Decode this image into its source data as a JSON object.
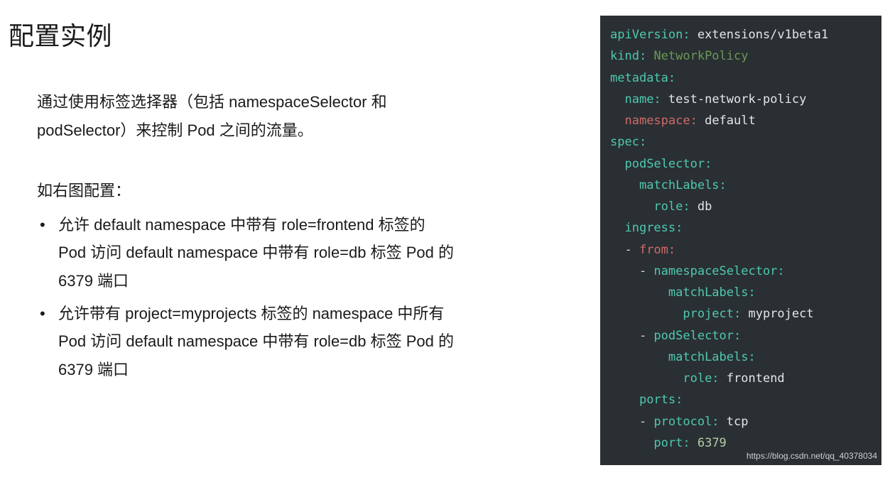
{
  "title": "配置实例",
  "intro_line1": "通过使用标签选择器（包括 namespaceSelector 和",
  "intro_line2": "podSelector）来控制 Pod 之间的流量。",
  "subheading": "如右图配置：",
  "bullets": [
    "允许 default namespace 中带有 role=frontend 标签的 Pod 访问 default namespace 中带有 role=db 标签 Pod 的 6379 端口",
    "允许带有 project=myprojects 标签的 namespace 中所有 Pod 访问 default namespace 中带有 role=db 标签 Pod 的 6379 端口"
  ],
  "code": {
    "l1_key": "apiVersion:",
    "l1_val": " extensions/v1beta1",
    "l2_key": "kind:",
    "l2_val": " NetworkPolicy",
    "l3_key": "metadata:",
    "l4_prefix": "  ",
    "l4_key": "name:",
    "l4_val": " test-network-policy",
    "l5_prefix": "  ",
    "l5_key": "namespace:",
    "l5_val": " default",
    "l6_key": "spec:",
    "l7_prefix": "  ",
    "l7_key": "podSelector:",
    "l8_prefix": "    ",
    "l8_key": "matchLabels:",
    "l9_prefix": "      ",
    "l9_key": "role:",
    "l9_val": " db",
    "l10_prefix": "  ",
    "l10_key": "ingress:",
    "l11_prefix": "  - ",
    "l11_key": "from:",
    "l12_prefix": "    - ",
    "l12_key": "namespaceSelector:",
    "l13_prefix": "        ",
    "l13_key": "matchLabels:",
    "l14_prefix": "          ",
    "l14_key": "project:",
    "l14_val": " myproject",
    "l15_prefix": "    - ",
    "l15_key": "podSelector:",
    "l16_prefix": "        ",
    "l16_key": "matchLabels:",
    "l17_prefix": "          ",
    "l17_key": "role:",
    "l17_val": " frontend",
    "l18_prefix": "    ",
    "l18_key": "ports:",
    "l19_prefix": "    - ",
    "l19_key": "protocol:",
    "l19_val": " tcp",
    "l20_prefix": "      ",
    "l20_key": "port:",
    "l20_val": " 6379"
  },
  "credit": "https://blog.csdn.net/qq_40378034"
}
